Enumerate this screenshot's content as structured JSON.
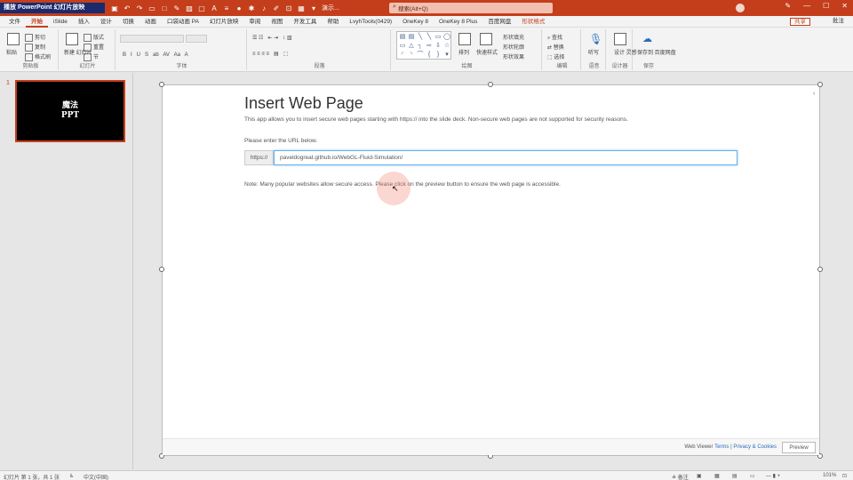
{
  "window": {
    "doc_title": "播放 PowerPoint 幻灯片放映",
    "file_name": "演示...",
    "search_placeholder": "搜索(Alt+Q)",
    "user": "",
    "controls": [
      "—",
      "☐",
      "✕"
    ]
  },
  "tabs": [
    {
      "label": "文件"
    },
    {
      "label": "开始",
      "active": true
    },
    {
      "label": "iSlide"
    },
    {
      "label": "插入"
    },
    {
      "label": "设计"
    },
    {
      "label": "切换"
    },
    {
      "label": "动画"
    },
    {
      "label": "口袋动画 PA"
    },
    {
      "label": "幻灯片放映"
    },
    {
      "label": "审阅"
    },
    {
      "label": "视图"
    },
    {
      "label": "开发工具"
    },
    {
      "label": "帮助"
    },
    {
      "label": "LvyhTools(0429)"
    },
    {
      "label": "OneKey 8"
    },
    {
      "label": "OneKey 8 Plus"
    },
    {
      "label": "百度网盘"
    },
    {
      "label": "形状格式",
      "special": true
    }
  ],
  "share_label": "共享",
  "comment_label": "批注",
  "ribbon": {
    "groups": [
      {
        "label": "剪贴板"
      },
      {
        "label": "幻灯片"
      },
      {
        "label": "字体"
      },
      {
        "label": "段落"
      },
      {
        "label": "绘图"
      },
      {
        "label": "编辑"
      },
      {
        "label": "语音"
      },
      {
        "label": "设计器"
      },
      {
        "label": "保存"
      }
    ],
    "clipboard": {
      "paste": "粘贴",
      "cut": "剪切",
      "copy": "复制",
      "format": "格式刷"
    },
    "slides": {
      "new": "新建\n幻灯片",
      "layout": "版式",
      "reset": "重置",
      "section": "节"
    },
    "drawing": {
      "arrange": "排列",
      "quick_styles": "快速样式",
      "fill": "形状填充",
      "outline": "形状轮廓",
      "effects": "形状效果"
    },
    "editing": {
      "find": "查找",
      "replace": "替换",
      "select": "选择"
    },
    "voice": {
      "dictate": "听写"
    },
    "designer": {
      "ideas": "设计\n灵感"
    },
    "save": {
      "baidu": "保存到\n百度网盘"
    }
  },
  "thumbnail": {
    "number": "1",
    "line1": "魔法",
    "line2": "PPT"
  },
  "dialog": {
    "title": "Insert Web Page",
    "description": "This app allows you to insert secure web pages starting with https:// into the slide deck. Non-secure web pages are not supported for security reasons.",
    "prompt": "Please enter the URL below.",
    "url_prefix": "https://",
    "url_value": "paveldogreat.github.io/WebGL-Fluid-Simulation/",
    "note": "Note: Many popular websites allow secure access. Please click on the preview button to ensure the web page is accessible."
  },
  "footer": {
    "brand": "Web Viewer",
    "terms": "Terms",
    "sep": "|",
    "privacy": "Privacy & Cookies",
    "preview_button": "Preview"
  },
  "statusbar": {
    "slide_info": "幻灯片 第 1 张，共 1 张",
    "language": "中文(中国)",
    "notes": "备注",
    "zoom": "101%"
  }
}
